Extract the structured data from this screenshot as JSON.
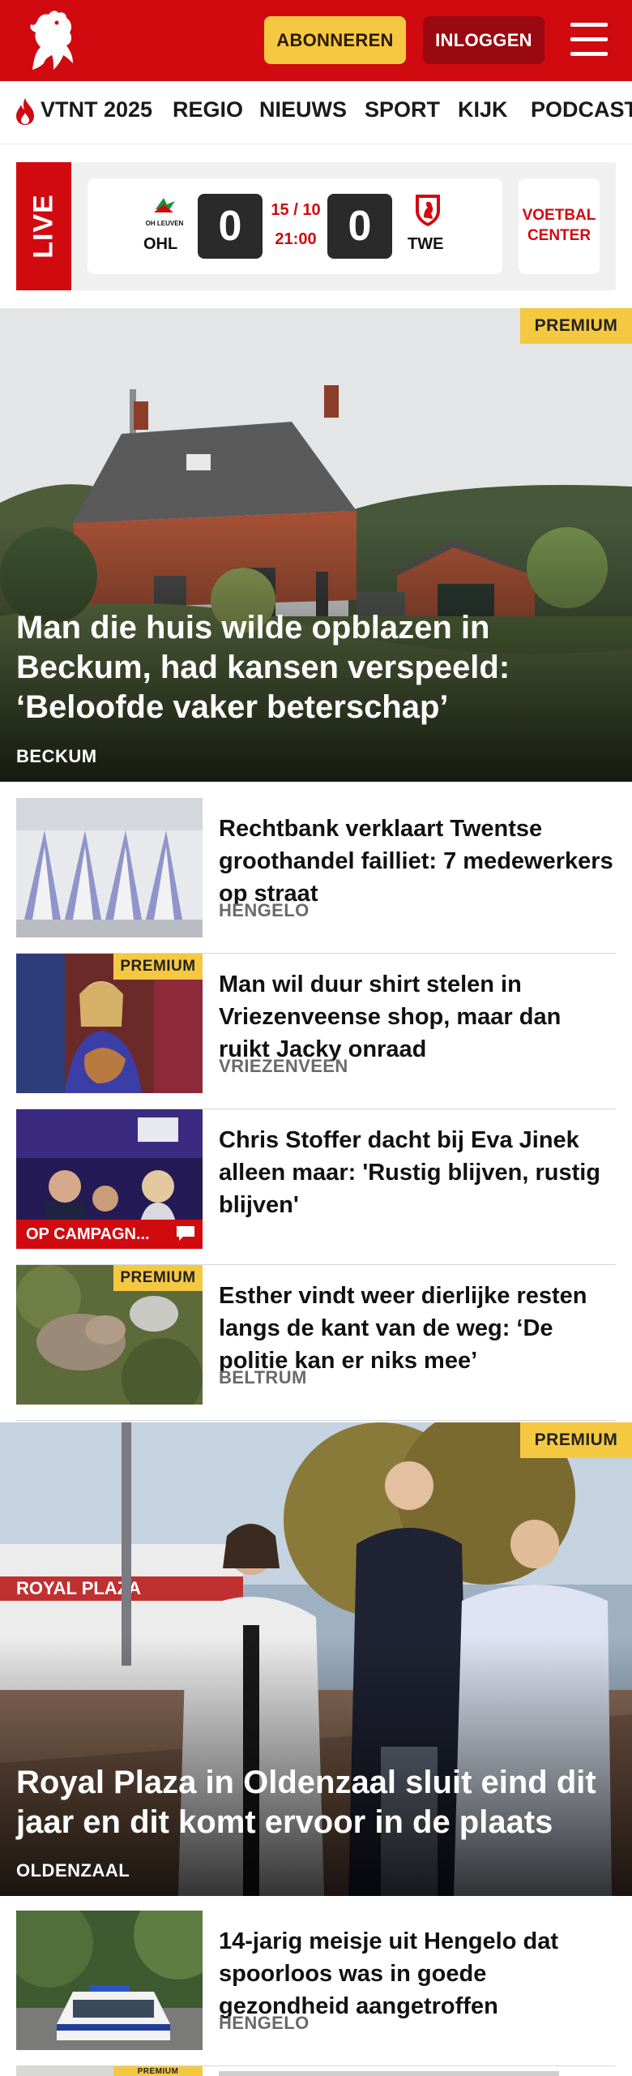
{
  "header": {
    "subscribe_label": "ABONNEREN",
    "login_label": "INLOGGEN",
    "colors": {
      "brand_red": "#d10a10",
      "accent_yellow": "#f5c842"
    }
  },
  "nav": {
    "items": [
      "VTNT 2025",
      "REGIO",
      "NIEUWS",
      "SPORT",
      "KIJK",
      "PODCAST"
    ]
  },
  "live": {
    "label": "LIVE",
    "home_team": {
      "sponsor": "OH LEUVEN",
      "code": "OHL",
      "score": "0"
    },
    "away_team": {
      "code": "TWE",
      "score": "0"
    },
    "date": "15 / 10",
    "time": "21:00",
    "voetbal_center_label": "VOETBAL CENTER"
  },
  "hero1": {
    "badge": "PREMIUM",
    "title": "Man die huis wilde opblazen in Beckum, had kansen verspeeld: ‘Beloofde vaker beterschap’",
    "location": "BECKUM"
  },
  "articles": [
    {
      "title": "Rechtbank verklaart Twentse groothandel failliet: 7 medewer­kers op straat",
      "location": "HENGELO"
    },
    {
      "badge": "PREMIUM",
      "title": "Man wil duur shirt stelen in Vriezenveense shop, maar dan ruikt Jacky onraad",
      "location": "VRIEZENVEEN"
    },
    {
      "title": "Chris Stoffer dacht bij Eva Jinek alleen maar: 'Rustig blijven, rustig blijven'",
      "tag": "OP CAMPAGN..."
    },
    {
      "badge": "PREMIUM",
      "title": "Esther vindt weer dierlijke resten langs de kant van de weg: ‘De politie kan er niks mee’",
      "location": "BELTRUM"
    }
  ],
  "hero2": {
    "badge": "PREMIUM",
    "title": "Royal Plaza in Oldenzaal sluit eind dit jaar en dit komt ervoor in de plaats",
    "location": "OLDENZAAL",
    "sign_text": "ROYAL PLAZA"
  },
  "article_last": {
    "title": "14-jarig meisje uit Hengelo dat spoorloos was in goede gezondheid aangetroffen",
    "location": "HENGELO"
  },
  "article_partial": {
    "badge": "PREMIUM"
  }
}
